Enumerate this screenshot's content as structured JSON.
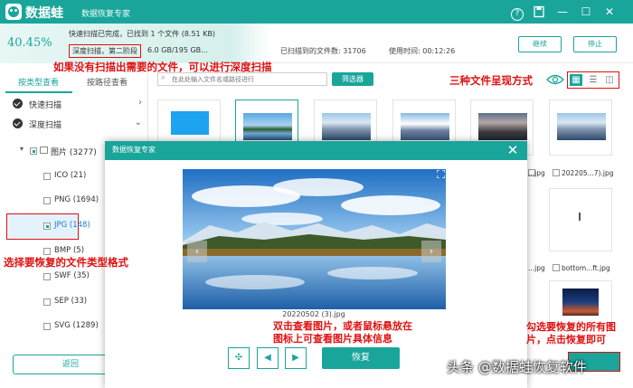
{
  "app": {
    "brand": "数据蛙",
    "subtitle": "数据恢复专家",
    "accent_color": "#1aa59b"
  },
  "status": {
    "progress_percent_text": "40.45%",
    "progress_percent": 40.45,
    "scan_line1": "快速扫描已完成，已找到 1 个文件 (8.51 KB)",
    "scan_phase": "深度扫描，第二阶段",
    "scan_size": "6.0 GB/195 GB...",
    "found_count": "已扫描到的文件数: 31706",
    "used_time": "使用时间: 00:12:26",
    "resume_label": "继续",
    "stop_label": "停止"
  },
  "sidebar": {
    "tab_type": "按类型查看",
    "tab_path": "按路径查看",
    "quick_scan": "快速扫描",
    "deep_scan": "深度扫描",
    "images": "图片 (3277)",
    "types": [
      {
        "label": "ICO (21)"
      },
      {
        "label": "PNG (1694)"
      },
      {
        "label": "JPG (148)"
      },
      {
        "label": "BMP (5)"
      },
      {
        "label": "SWF (35)"
      },
      {
        "label": "SEP (33)"
      },
      {
        "label": "SVG (1289)"
      }
    ],
    "back_label": "返回"
  },
  "toolbar": {
    "search_placeholder": "在此处输入文件名或路径进行",
    "filter_label": "筛选器"
  },
  "thumbnails": {
    "labels": [
      "...jpg",
      "202205...7).jpg",
      "...jpg",
      "bottom...ft.jpg",
      "...jpg"
    ]
  },
  "dialog": {
    "title": "数据恢复专家",
    "file_name": "20220502 (3).jpg",
    "recover_label": "恢复"
  },
  "annotations": {
    "deep_scan_tip": "如果没有扫描出需要的文件，可以进行深度扫描",
    "view_modes_tip": "三种文件呈现方式",
    "select_type_tip": "选择要恢复的文件类型格式",
    "preview_tip_1": "双击查看图片，或者鼠标悬放在",
    "preview_tip_2": "图标上可查看图片具体信息",
    "recover_tip_1": "勾选要恢复的所有图",
    "recover_tip_2": "片，点击恢复即可"
  },
  "watermark": "头条 @数据蛙恢复软件",
  "icons": [
    "logo-icon",
    "help-icon",
    "save-icon",
    "minimize-icon",
    "maximize-icon",
    "close-icon",
    "search-icon",
    "eye-icon",
    "grid-view-icon",
    "list-view-icon",
    "detail-view-icon",
    "expand-icon",
    "fit-icon",
    "prev-icon",
    "next-icon"
  ]
}
